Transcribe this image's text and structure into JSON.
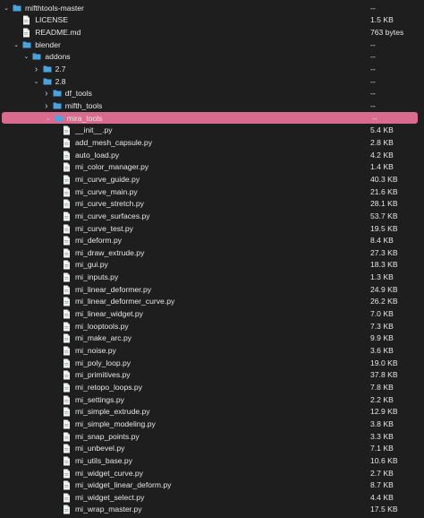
{
  "colors": {
    "background": "#1e1e1e",
    "selection": "#d96b8f",
    "folder": "#4aa3df",
    "text": "#e6e6e6"
  },
  "rows": [
    {
      "name": "mifthtools-master",
      "size": "--",
      "type": "folder",
      "depth": 0,
      "expanded": true
    },
    {
      "name": "LICENSE",
      "size": "1.5 KB",
      "type": "file",
      "depth": 1
    },
    {
      "name": "README.md",
      "size": "763 bytes",
      "type": "file",
      "depth": 1
    },
    {
      "name": "blender",
      "size": "--",
      "type": "folder",
      "depth": 1,
      "expanded": true
    },
    {
      "name": "addons",
      "size": "--",
      "type": "folder",
      "depth": 2,
      "expanded": true
    },
    {
      "name": "2.7",
      "size": "--",
      "type": "folder",
      "depth": 3,
      "expanded": false
    },
    {
      "name": "2.8",
      "size": "--",
      "type": "folder",
      "depth": 3,
      "expanded": true
    },
    {
      "name": "df_tools",
      "size": "--",
      "type": "folder",
      "depth": 4,
      "expanded": false
    },
    {
      "name": "mifth_tools",
      "size": "--",
      "type": "folder",
      "depth": 4,
      "expanded": false
    },
    {
      "name": "mira_tools",
      "size": "--",
      "type": "folder",
      "depth": 4,
      "expanded": true,
      "selected": true
    },
    {
      "name": "__init__.py",
      "size": "5.4 KB",
      "type": "file",
      "depth": 5
    },
    {
      "name": "add_mesh_capsule.py",
      "size": "2.8 KB",
      "type": "file",
      "depth": 5
    },
    {
      "name": "auto_load.py",
      "size": "4.2 KB",
      "type": "file",
      "depth": 5
    },
    {
      "name": "mi_color_manager.py",
      "size": "1.4 KB",
      "type": "file",
      "depth": 5
    },
    {
      "name": "mi_curve_guide.py",
      "size": "40.3 KB",
      "type": "file",
      "depth": 5
    },
    {
      "name": "mi_curve_main.py",
      "size": "21.6 KB",
      "type": "file",
      "depth": 5
    },
    {
      "name": "mi_curve_stretch.py",
      "size": "28.1 KB",
      "type": "file",
      "depth": 5
    },
    {
      "name": "mi_curve_surfaces.py",
      "size": "53.7 KB",
      "type": "file",
      "depth": 5
    },
    {
      "name": "mi_curve_test.py",
      "size": "19.5 KB",
      "type": "file",
      "depth": 5
    },
    {
      "name": "mi_deform.py",
      "size": "8.4 KB",
      "type": "file",
      "depth": 5
    },
    {
      "name": "mi_draw_extrude.py",
      "size": "27.3 KB",
      "type": "file",
      "depth": 5
    },
    {
      "name": "mi_gui.py",
      "size": "18.3 KB",
      "type": "file",
      "depth": 5
    },
    {
      "name": "mi_inputs.py",
      "size": "1.3 KB",
      "type": "file",
      "depth": 5
    },
    {
      "name": "mi_linear_deformer.py",
      "size": "24.9 KB",
      "type": "file",
      "depth": 5
    },
    {
      "name": "mi_linear_deformer_curve.py",
      "size": "26.2 KB",
      "type": "file",
      "depth": 5
    },
    {
      "name": "mi_linear_widget.py",
      "size": "7.0 KB",
      "type": "file",
      "depth": 5
    },
    {
      "name": "mi_looptools.py",
      "size": "7.3 KB",
      "type": "file",
      "depth": 5
    },
    {
      "name": "mi_make_arc.py",
      "size": "9.9 KB",
      "type": "file",
      "depth": 5
    },
    {
      "name": "mi_noise.py",
      "size": "3.6 KB",
      "type": "file",
      "depth": 5
    },
    {
      "name": "mi_poly_loop.py",
      "size": "19.0 KB",
      "type": "file",
      "depth": 5
    },
    {
      "name": "mi_primitives.py",
      "size": "37.8 KB",
      "type": "file",
      "depth": 5
    },
    {
      "name": "mi_retopo_loops.py",
      "size": "7.8 KB",
      "type": "file",
      "depth": 5
    },
    {
      "name": "mi_settings.py",
      "size": "2.2 KB",
      "type": "file",
      "depth": 5
    },
    {
      "name": "mi_simple_extrude.py",
      "size": "12.9 KB",
      "type": "file",
      "depth": 5
    },
    {
      "name": "mi_simple_modeling.py",
      "size": "3.8 KB",
      "type": "file",
      "depth": 5
    },
    {
      "name": "mi_snap_points.py",
      "size": "3.3 KB",
      "type": "file",
      "depth": 5
    },
    {
      "name": "mi_unbevel.py",
      "size": "7.1 KB",
      "type": "file",
      "depth": 5
    },
    {
      "name": "mi_utils_base.py",
      "size": "10.6 KB",
      "type": "file",
      "depth": 5
    },
    {
      "name": "mi_widget_curve.py",
      "size": "2.7 KB",
      "type": "file",
      "depth": 5
    },
    {
      "name": "mi_widget_linear_deform.py",
      "size": "8.7 KB",
      "type": "file",
      "depth": 5
    },
    {
      "name": "mi_widget_select.py",
      "size": "4.4 KB",
      "type": "file",
      "depth": 5
    },
    {
      "name": "mi_wrap_master.py",
      "size": "17.5 KB",
      "type": "file",
      "depth": 5
    }
  ]
}
